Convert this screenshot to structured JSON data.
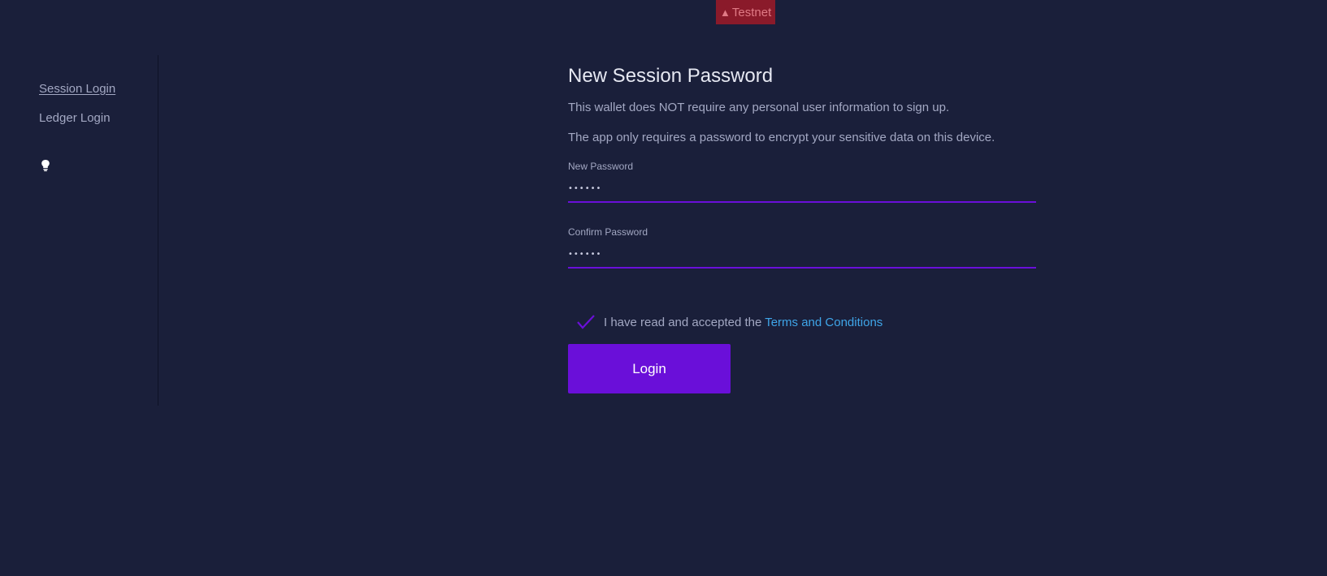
{
  "badge": {
    "icon": "warning-icon",
    "label": "Testnet",
    "bg_color": "#8a1a2a"
  },
  "sidebar": {
    "items": [
      {
        "label": "Session Login",
        "active": true
      },
      {
        "label": "Ledger Login",
        "active": false
      }
    ],
    "theme_icon": "lightbulb-icon"
  },
  "main": {
    "title": "New Session Password",
    "paragraphs": [
      "This wallet does NOT require any personal user information to sign up.",
      "The app only requires a password to encrypt your sensitive data on this device."
    ],
    "new_password": {
      "label": "New Password",
      "value": "••••••"
    },
    "confirm_password": {
      "label": "Confirm Password",
      "value": "••••••"
    },
    "terms": {
      "checked": true,
      "text": "I have read and accepted the ",
      "link_text": "Terms and Conditions"
    },
    "login_button": "Login"
  },
  "colors": {
    "background": "#1a1f3a",
    "accent": "#6a0fd9",
    "link": "#3fa5e8"
  }
}
